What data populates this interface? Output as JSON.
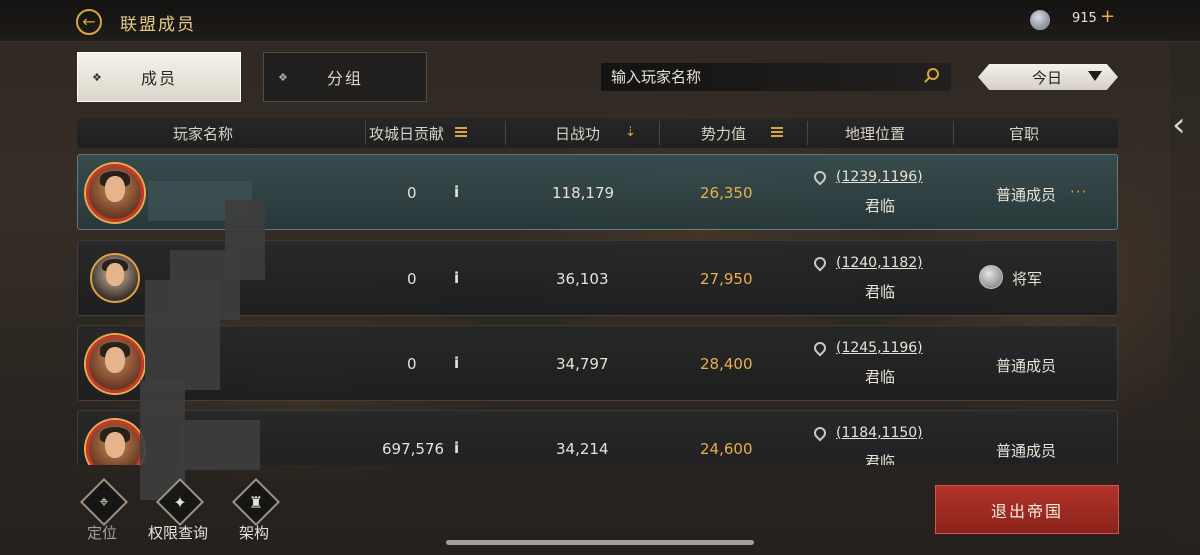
{
  "header": {
    "title": "联盟成员",
    "currency_value": "915",
    "currency_add": "+"
  },
  "tabs": {
    "members": "成员",
    "groups": "分组"
  },
  "search": {
    "placeholder": "输入玩家名称"
  },
  "date_filter": {
    "selected": "今日"
  },
  "table": {
    "columns": [
      "玩家名称",
      "攻城日贡献",
      "日战功",
      "势力值",
      "地理位置",
      "官职"
    ],
    "rows": [
      {
        "siege": "0",
        "merit": "118,179",
        "power": "26,350",
        "coord": "(1239,1196)",
        "place": "君临",
        "rank": "普通成员",
        "more": "···"
      },
      {
        "siege": "0",
        "merit": "36,103",
        "power": "27,950",
        "coord": "(1240,1182)",
        "place": "君临",
        "rank": "将军"
      },
      {
        "siege": "0",
        "merit": "34,797",
        "power": "28,400",
        "coord": "(1245,1196)",
        "place": "君临",
        "rank": "普通成员"
      },
      {
        "siege": "697,576",
        "merit": "34,214",
        "power": "24,600",
        "coord": "(1184,1150)",
        "place": "君临",
        "rank": "普通成员"
      }
    ],
    "info_glyph": "i"
  },
  "bottom": {
    "locate": "定位",
    "permissions": "权限查询",
    "structure": "架构",
    "exit": "退出帝国"
  },
  "colors": {
    "accent": "#d9a441",
    "exit_button": "#b3342a",
    "selected_row": "#384e50"
  }
}
